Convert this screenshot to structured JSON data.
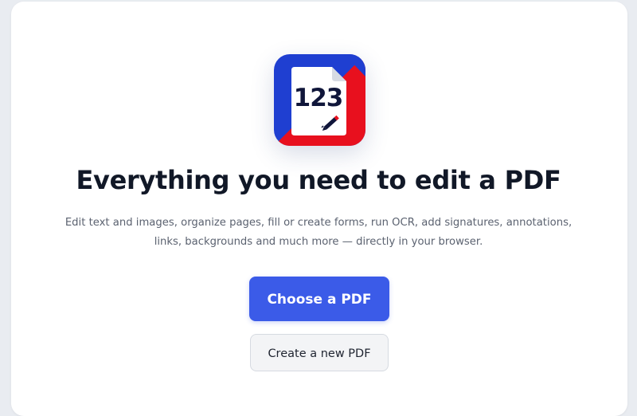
{
  "app": {
    "logo_icon": "pdf-editor-logo",
    "logo_text": "123",
    "colors": {
      "logo_blue": "#1f3fd1",
      "logo_red": "#e8101e",
      "primary_button": "#3b5be8"
    }
  },
  "hero": {
    "headline": "Everything you need to edit a PDF",
    "description": "Edit text and images, organize pages, fill or create forms, run OCR, add signatures, annotations, links, backgrounds and much more — directly in your browser."
  },
  "actions": {
    "choose_label": "Choose a PDF",
    "create_label": "Create a new PDF"
  }
}
